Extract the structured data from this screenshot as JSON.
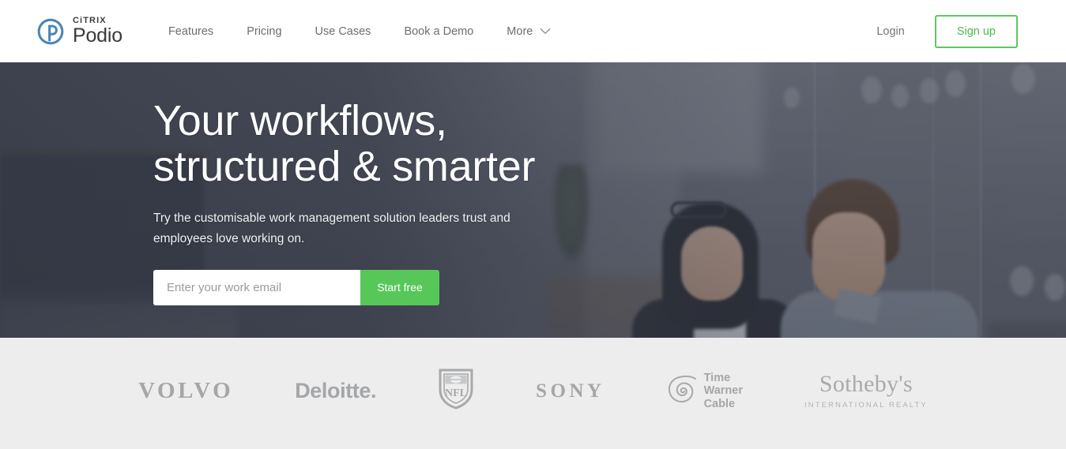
{
  "header": {
    "brand": {
      "logo_icon": "podio-circle-p-icon",
      "citrix": "CiTRIX",
      "podio": "Podio",
      "mark_color": "#4a86b8"
    },
    "nav": [
      {
        "label": "Features",
        "icon": null
      },
      {
        "label": "Pricing",
        "icon": null
      },
      {
        "label": "Use Cases",
        "icon": null
      },
      {
        "label": "Book a Demo",
        "icon": null
      },
      {
        "label": "More",
        "icon": "chevron-down-icon"
      }
    ],
    "login_label": "Login",
    "signup_label": "Sign up",
    "signup_color": "#5cc95e"
  },
  "hero": {
    "title_line1": "Your workflows,",
    "title_line2": "structured & smarter",
    "subtitle_line1": "Try the customisable work management solution leaders trust and",
    "subtitle_line2": "employees love working on.",
    "email_placeholder": "Enter your work email",
    "email_value": "",
    "cta_label": "Start free",
    "cta_color": "#57c75a",
    "background_description": "Two colleagues smiling at a laptop in a modern office with glass partitions"
  },
  "logos": {
    "items": [
      {
        "name": "volvo",
        "text": "VOLVO"
      },
      {
        "name": "deloitte",
        "text": "Deloitte."
      },
      {
        "name": "nfl",
        "text": "NFL"
      },
      {
        "name": "sony",
        "text": "SONY"
      },
      {
        "name": "time-warner-cable",
        "line1": "Time",
        "line2": "Warner",
        "line3": "Cable"
      },
      {
        "name": "sothebys",
        "main": "Sotheby's",
        "sub": "INTERNATIONAL REALTY"
      }
    ],
    "band_color": "#ededed",
    "logo_color": "#a7a9ab"
  }
}
